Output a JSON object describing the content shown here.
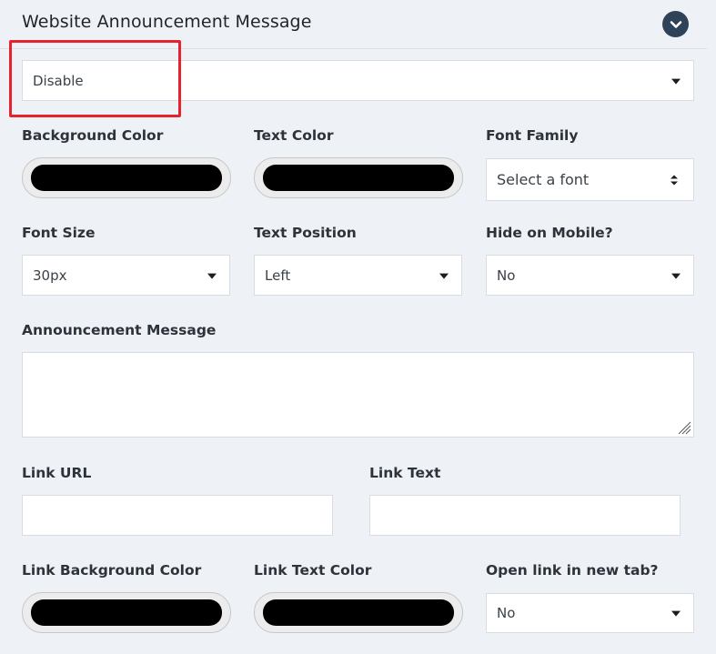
{
  "header": {
    "title": "Website Announcement Message"
  },
  "status_select": {
    "value": "Disable"
  },
  "labels": {
    "background_color": "Background Color",
    "text_color": "Text Color",
    "font_family": "Font Family",
    "font_size": "Font Size",
    "text_position": "Text Position",
    "hide_on_mobile": "Hide on Mobile?",
    "announcement_message": "Announcement Message",
    "link_url": "Link URL",
    "link_text": "Link Text",
    "link_background_color": "Link Background Color",
    "link_text_color": "Link Text Color",
    "open_link_new_tab": "Open link in new tab?"
  },
  "values": {
    "font_family": "Select a font",
    "font_size": "30px",
    "text_position": "Left",
    "hide_on_mobile": "No",
    "announcement_message": "",
    "link_url": "",
    "link_text": "",
    "open_link_new_tab": "No"
  },
  "colors": {
    "background_color": "#000000",
    "text_color": "#000000",
    "link_background_color": "#000000",
    "link_text_color": "#000000",
    "highlight": "#e5222d",
    "collapse_button": "#2f4358"
  },
  "icons": {
    "collapse": "chevron-down-icon",
    "dropdown": "caret-down-icon",
    "font_select": "sort-updown-icon",
    "resize": "resize-grip-icon"
  }
}
